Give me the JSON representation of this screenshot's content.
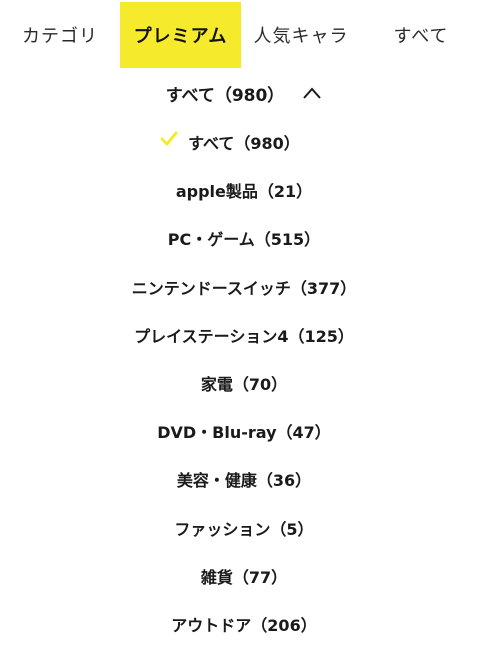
{
  "tabs": [
    {
      "label": "カテゴリ",
      "active": false
    },
    {
      "label": "プレミアム",
      "active": true
    },
    {
      "label": "人気キャラ",
      "active": false
    },
    {
      "label": "すべて",
      "active": false
    }
  ],
  "colors": {
    "accent": "#f6ea2d",
    "text": "#1a1a1a"
  },
  "dropdown": {
    "selected_label": "すべて（980）",
    "toggle_icon": "chevron-up-icon",
    "options": [
      {
        "label": "すべて（980）",
        "selected": true
      },
      {
        "label": "apple製品（21）",
        "selected": false
      },
      {
        "label": "PC・ゲーム（515）",
        "selected": false
      },
      {
        "label": "ニンテンドースイッチ（377）",
        "selected": false
      },
      {
        "label": "プレイステーション4（125）",
        "selected": false
      },
      {
        "label": "家電（70）",
        "selected": false
      },
      {
        "label": "DVD・Blu-ray（47）",
        "selected": false
      },
      {
        "label": "美容・健康（36）",
        "selected": false
      },
      {
        "label": "ファッション（5）",
        "selected": false
      },
      {
        "label": "雑貨（77）",
        "selected": false
      },
      {
        "label": "アウトドア（206）",
        "selected": false
      }
    ],
    "selected_icon": "check-icon"
  }
}
